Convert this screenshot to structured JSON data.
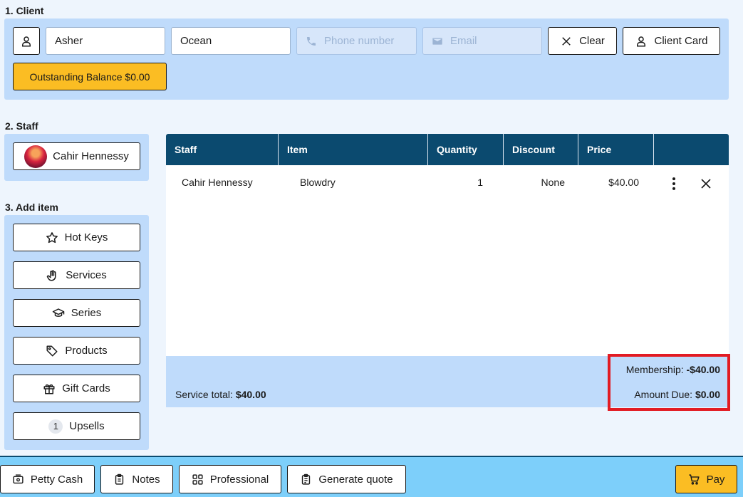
{
  "client": {
    "section_label": "1. Client",
    "first_name": "Asher",
    "last_name": "Ocean",
    "phone_placeholder": "Phone number",
    "email_placeholder": "Email",
    "clear_label": "Clear",
    "client_card_label": "Client Card",
    "outstanding_balance_label": "Outstanding Balance $0.00"
  },
  "staff": {
    "section_label": "2. Staff",
    "selected_name": "Cahir Hennessy"
  },
  "add_item": {
    "section_label": "3. Add item",
    "buttons": [
      {
        "label": "Hot Keys",
        "icon": "star-icon"
      },
      {
        "label": "Services",
        "icon": "hand-icon"
      },
      {
        "label": "Series",
        "icon": "graduation-cap-icon"
      },
      {
        "label": "Products",
        "icon": "tag-icon"
      },
      {
        "label": "Gift Cards",
        "icon": "gift-icon"
      },
      {
        "label": "Upsells",
        "badge": "1"
      }
    ]
  },
  "table": {
    "columns": [
      "Staff",
      "Item",
      "Quantity",
      "Discount",
      "Price"
    ],
    "rows": [
      {
        "staff": "Cahir Hennessy",
        "item": "Blowdry",
        "quantity": "1",
        "discount": "None",
        "price": "$40.00"
      }
    ],
    "footer": {
      "service_total_label": "Service total:",
      "service_total_value": "$40.00",
      "membership_label": "Membership:",
      "membership_value": "-$40.00",
      "amount_due_label": "Amount Due:",
      "amount_due_value": "$0.00"
    }
  },
  "bottom_bar": {
    "petty_cash": "Petty Cash",
    "notes": "Notes",
    "professional": "Professional",
    "generate_quote": "Generate quote",
    "pay": "Pay"
  },
  "colors": {
    "panel": "#bfdbfb",
    "header": "#0b4a6f",
    "accent_yellow": "#fbbd23",
    "highlight_red": "#e21b23",
    "bottom_bar": "#7dcffa"
  }
}
